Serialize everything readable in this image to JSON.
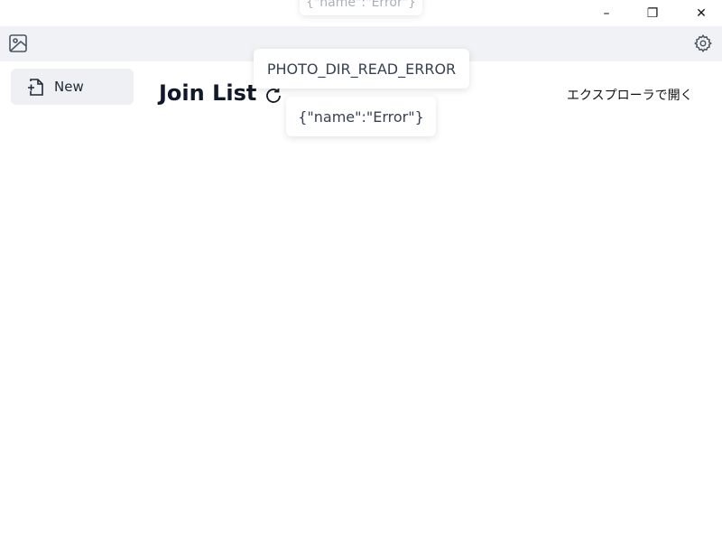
{
  "window": {
    "minimize_glyph": "–",
    "maximize_glyph": "❐",
    "close_glyph": "✕"
  },
  "toolbar": {
    "left_icon": "image-icon",
    "right_icon": "gear-icon"
  },
  "sidebar": {
    "items": [
      {
        "label": "New",
        "icon": "file-plus-icon"
      }
    ]
  },
  "main": {
    "title": "Join List",
    "refresh_icon": "refresh-icon",
    "open_explorer_label": "エクスプローラで開く"
  },
  "toasts": [
    {
      "text": "{\"name\":\"Error\"}"
    },
    {
      "text": "PHOTO_DIR_READ_ERROR"
    },
    {
      "text": "{\"name\":\"Error\"}"
    }
  ]
}
